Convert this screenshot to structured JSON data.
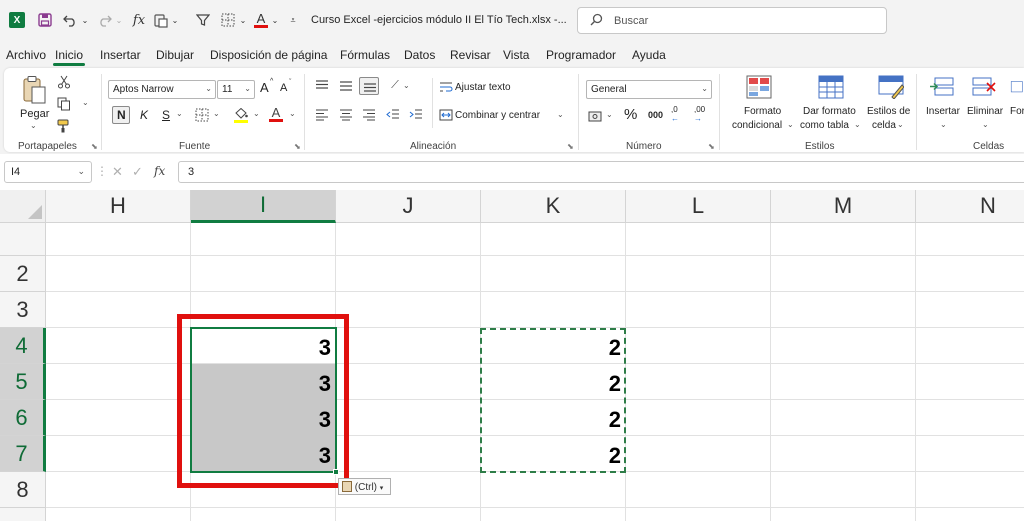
{
  "titlebar": {
    "app_icon": "excel-logo",
    "app_letter": "X",
    "doc_title": "Curso Excel -ejercicios módulo II El Tío Tech.xlsx  -...",
    "search_placeholder": "Buscar",
    "icons": [
      "save-icon",
      "undo-icon",
      "redo-icon",
      "function-icon",
      "paste-special-icon",
      "filter-icon",
      "borders-icon",
      "font-color-icon",
      "customize-icon"
    ]
  },
  "menu": {
    "tabs": [
      "Archivo",
      "Inicio",
      "Insertar",
      "Dibujar",
      "Disposición de página",
      "Fórmulas",
      "Datos",
      "Revisar",
      "Vista",
      "Programador",
      "Ayuda"
    ],
    "active": "Inicio"
  },
  "ribbon": {
    "clipboard": {
      "paste_label": "Pegar",
      "group_label": "Portapapeles"
    },
    "font": {
      "font_name": "Aptos Narrow",
      "font_size": "11",
      "bold": "N",
      "italic": "K",
      "underline": "S",
      "grow": "A",
      "shrink": "A",
      "color_letter": "A",
      "group_label": "Fuente"
    },
    "alignment": {
      "wrap_text": "Ajustar texto",
      "merge_center": "Combinar y centrar",
      "group_label": "Alineación"
    },
    "number": {
      "format": "General",
      "percent": "%",
      "thousands": "000",
      "inc_decimal": ",0",
      "dec_decimal": ",00",
      "group_label": "Número"
    },
    "styles": {
      "conditional_1": "Formato",
      "conditional_2": "condicional",
      "table_1": "Dar formato",
      "table_2": "como tabla",
      "cell_1": "Estilos de",
      "cell_2": "celda",
      "group_label": "Estilos"
    },
    "cells": {
      "insert": "Insertar",
      "delete": "Eliminar",
      "format": "Form",
      "group_label": "Celdas"
    }
  },
  "formula_bar": {
    "name_box": "I4",
    "fx": "fx",
    "value": "3"
  },
  "sheet": {
    "columns": [
      "H",
      "I",
      "J",
      "K",
      "L",
      "M",
      "N"
    ],
    "selected_column": "I",
    "rows": [
      "2",
      "3",
      "4",
      "5",
      "6",
      "7",
      "8"
    ],
    "selected_rows": [
      "4",
      "5",
      "6",
      "7"
    ],
    "column_i_values": [
      "3",
      "3",
      "3",
      "3"
    ],
    "column_k_values": [
      "2",
      "2",
      "2",
      "2"
    ],
    "paste_options": "(Ctrl)"
  },
  "colors": {
    "accent": "#107c41",
    "highlight_box": "#e0100e",
    "selection_fill": "#c8c8c8"
  }
}
